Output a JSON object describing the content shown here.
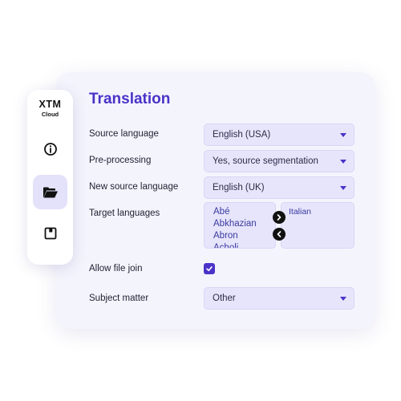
{
  "brand": {
    "name": "XTM",
    "sub": "Cloud"
  },
  "sidebar": {
    "items": [
      {
        "icon": "info-icon",
        "active": false
      },
      {
        "icon": "folder-open-icon",
        "active": true
      },
      {
        "icon": "save-icon",
        "active": false
      }
    ]
  },
  "page": {
    "title": "Translation"
  },
  "form": {
    "source_language": {
      "label": "Source language",
      "value": "English (USA)"
    },
    "pre_processing": {
      "label": "Pre-processing",
      "value": "Yes, source segmentation"
    },
    "new_source_language": {
      "label": "New source language",
      "value": "English (UK)"
    },
    "target_languages": {
      "label": "Target languages",
      "available": [
        "Abé",
        "Abkhazian",
        "Abron",
        "Acholi"
      ],
      "selected": [
        "Italian"
      ]
    },
    "allow_file_join": {
      "label": "Allow file join",
      "checked": true
    },
    "subject_matter": {
      "label": "Subject matter",
      "value": "Other"
    }
  },
  "colors": {
    "accent": "#4a32c8",
    "card_bg": "#f4f4fc",
    "field_bg": "#e7e5fb"
  }
}
